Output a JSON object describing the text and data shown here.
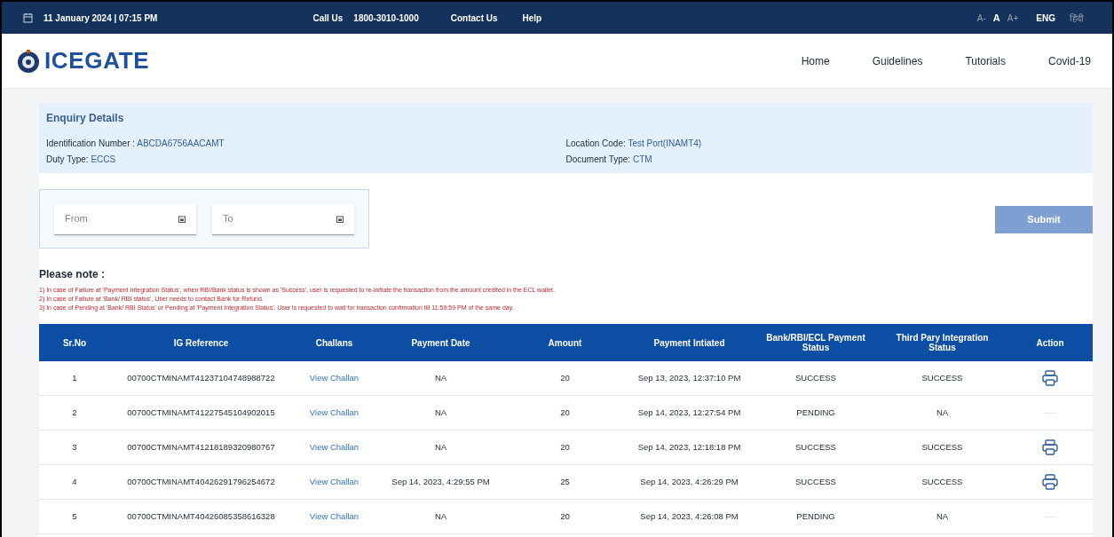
{
  "top_bar": {
    "datetime": "11 January 2024 | 07:15 PM",
    "call_label": "Call Us",
    "phone": "1800-3010-1000",
    "links": [
      "Contact Us",
      "Help"
    ],
    "font_sizes": [
      {
        "label": "A-",
        "selected": false
      },
      {
        "label": "A",
        "selected": true
      },
      {
        "label": "A+",
        "selected": false
      }
    ],
    "languages": [
      {
        "label": "ENG",
        "selected": true
      },
      {
        "label": "हिंदी",
        "selected": false
      }
    ]
  },
  "header": {
    "logo_text": "ICEGATE",
    "nav": [
      "Home",
      "Guidelines",
      "Tutorials",
      "Covid-19"
    ]
  },
  "enquiry": {
    "title": "Enquiry Details",
    "fields": [
      {
        "label": "Identification Number :",
        "value": "ABCDA6756AACAMT"
      },
      {
        "label": "Location Code:",
        "value": "Test Port(INAMT4)"
      },
      {
        "label": "Duty Type:",
        "value": "ECCS"
      },
      {
        "label": "Document Type:",
        "value": "CTM"
      }
    ]
  },
  "filter": {
    "from": {
      "placeholder": "From"
    },
    "to": {
      "placeholder": "To"
    },
    "submit": "Submit"
  },
  "note": {
    "title": "Please note :",
    "items": [
      "1) In case of Failure at 'Payment Integration Status', when RBI/Bank status is shown as 'Success', user is requested to re-initiate the transaction from the amount credited in the ECL wallet.",
      "2) In case of Failure at 'Bank/ RBI status', User needs to contact Bank for Refund.",
      "3) In case of Pending at 'Bank/ RBI Status' or Pending at 'Payment Integration Status'. User is requested to wait for transaction confirmation till 11:59:59 PM of the same day."
    ]
  },
  "table": {
    "columns": [
      "Sr.No",
      "IG Reference",
      "Challans",
      "Payment Date",
      "Amount",
      "Payment Intiated",
      "Bank/RBI/ECL Payment Status",
      "Third Pary Integration Status",
      "Action"
    ],
    "rows": [
      {
        "sr": "1",
        "ref": "00700CTMINAMT41237104748988722",
        "challan": "View Challan",
        "payment_date": "NA",
        "amount": "20",
        "initiated": "Sep 13, 2023, 12:37:10 PM",
        "bank_status": "SUCCESS",
        "integration_status": "SUCCESS",
        "printable": true
      },
      {
        "sr": "2",
        "ref": "00700CTMINAMT41227545104902015",
        "challan": "View Challan",
        "payment_date": "NA",
        "amount": "20",
        "initiated": "Sep 14, 2023, 12:27:54 PM",
        "bank_status": "PENDING",
        "integration_status": "NA",
        "printable": false
      },
      {
        "sr": "3",
        "ref": "00700CTMINAMT41218189320980767",
        "challan": "View Challan",
        "payment_date": "NA",
        "amount": "20",
        "initiated": "Sep 14, 2023, 12:18:18 PM",
        "bank_status": "SUCCESS",
        "integration_status": "SUCCESS",
        "printable": true
      },
      {
        "sr": "4",
        "ref": "00700CTMINAMT40426291796254672",
        "challan": "View Challan",
        "payment_date": "Sep 14, 2023, 4:29:55 PM",
        "amount": "25",
        "initiated": "Sep 14, 2023, 4:26:29 PM",
        "bank_status": "SUCCESS",
        "integration_status": "SUCCESS",
        "printable": true
      },
      {
        "sr": "5",
        "ref": "00700CTMINAMT40426085358616328",
        "challan": "View Challan",
        "payment_date": "NA",
        "amount": "20",
        "initiated": "Sep 14, 2023, 4:26:08 PM",
        "bank_status": "PENDING",
        "integration_status": "NA",
        "printable": false
      }
    ]
  }
}
